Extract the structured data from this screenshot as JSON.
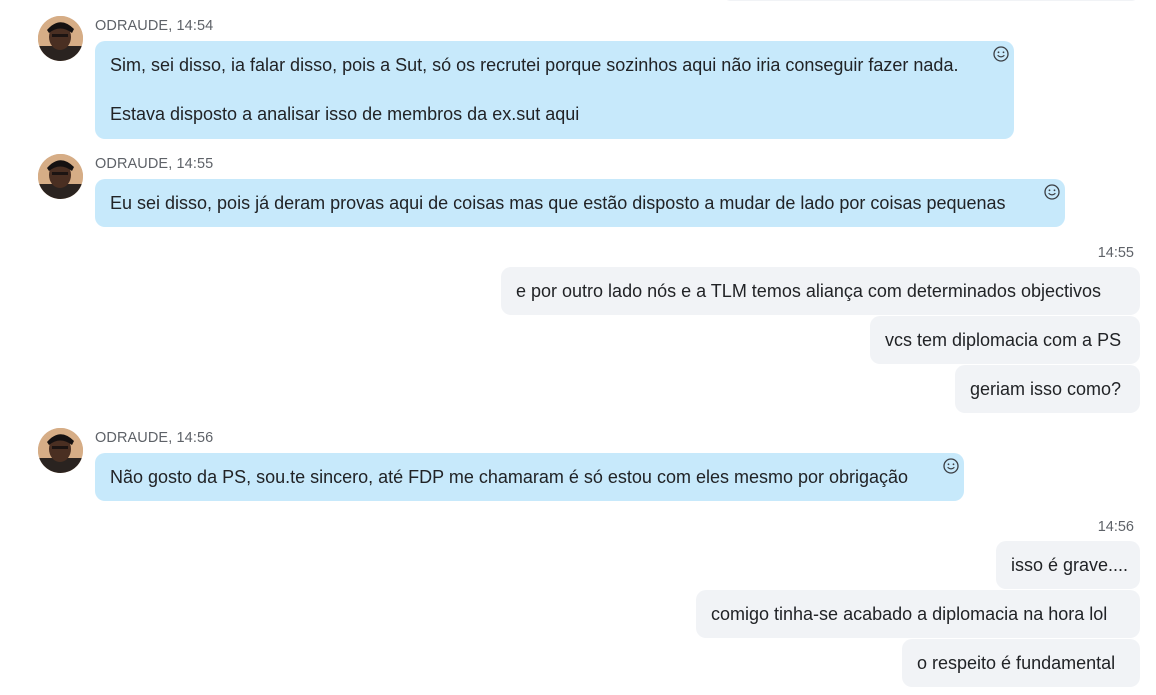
{
  "colors": {
    "incoming_bubble": "#c7e9fb",
    "outgoing_bubble": "#f1f3f6",
    "meta_text": "#5e6268",
    "body_text": "#212326"
  },
  "icons": {
    "avatar": "user-avatar-photo",
    "reaction": "smiley-face-icon"
  },
  "messages": [
    {
      "sender": "ODRAUDE,",
      "time": "14:54",
      "paragraphs": [
        "Sim, sei disso, ia falar disso, pois a Sut, só os recrutei porque sozinhos aqui não iria conseguir fazer nada.",
        "Estava disposto a analisar isso de membros da ex.sut aqui"
      ]
    },
    {
      "sender": "ODRAUDE,",
      "time": "14:55",
      "text": "Eu sei disso, pois já deram provas aqui de coisas mas que estão disposto a mudar de lado por coisas pequenas"
    },
    {
      "time": "14:55",
      "outgoing": [
        "e por outro lado nós e a TLM temos aliança com determinados objectivos",
        "vcs tem diplomacia com a PS",
        "geriam isso como?"
      ]
    },
    {
      "sender": "ODRAUDE,",
      "time": "14:56",
      "text": "Não gosto da PS, sou.te sincero, até FDP me chamaram é só estou com eles mesmo por obrigação"
    },
    {
      "time": "14:56",
      "outgoing": [
        "isso é grave....",
        "comigo tinha-se acabado a diplomacia na hora lol",
        "o respeito é fundamental"
      ]
    }
  ]
}
